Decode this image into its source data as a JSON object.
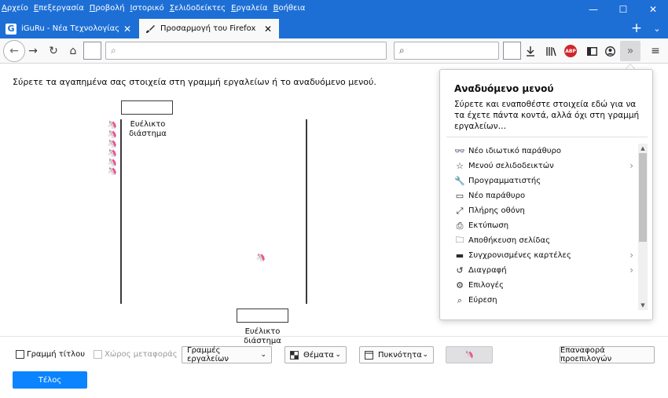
{
  "menubar": [
    "Αρχείο",
    "Επεξεργασία",
    "Προβολή",
    "Ιστορικό",
    "Σελιδοδείκτες",
    "Εργαλεία",
    "Βοήθεια"
  ],
  "window_controls": {
    "minimize": "—",
    "maximize": "☐",
    "close": "✕"
  },
  "tabs": [
    {
      "favicon": "G",
      "label": "iGuRu - Νέα Τεχνολογίας σε πρ",
      "close": "✕"
    },
    {
      "favicon": "paintbrush-icon",
      "label": "Προσαρμογή του Firefox",
      "close": "✕"
    }
  ],
  "tabbar": {
    "add": "+",
    "list": "⌄"
  },
  "navbar": {
    "back": "←",
    "forward": "→",
    "reload": "↻",
    "home": "⌂",
    "search_glyph": "⌕",
    "abp_label": "ABP",
    "overflow": "»",
    "menu": "≡"
  },
  "customize": {
    "instructions": "Σύρετε τα αγαπημένα σας στοιχεία στη γραμμή εργαλείων ή το αναδυόμενο μενού.",
    "flex_label_1": "Ευέλικτο διάστημα",
    "flex_label_2": "Ευέλικτο διάστημα"
  },
  "overflow_panel": {
    "title": "Αναδυόμενο μενού",
    "description": "Σύρετε και εναποθέστε στοιχεία εδώ για να τα έχετε πάντα κοντά, αλλά όχι στη γραμμή εργαλείων…",
    "items": [
      {
        "icon": "mask-icon",
        "glyph": "👓",
        "label": "Νέο ιδιωτικό παράθυρο",
        "submenu": false
      },
      {
        "icon": "bookmark-star-icon",
        "glyph": "☆",
        "label": "Μενού σελιδοδεικτών",
        "submenu": true
      },
      {
        "icon": "wrench-icon",
        "glyph": "🔧",
        "label": "Προγραμματιστής",
        "submenu": false
      },
      {
        "icon": "window-icon",
        "glyph": "▭",
        "label": "Νέο παράθυρο",
        "submenu": false
      },
      {
        "icon": "fullscreen-icon",
        "glyph": "⤢",
        "label": "Πλήρης οθόνη",
        "submenu": false
      },
      {
        "icon": "printer-icon",
        "glyph": "⎙",
        "label": "Εκτύπωση",
        "submenu": false
      },
      {
        "icon": "folder-icon",
        "glyph": "🗀",
        "label": "Αποθήκευση σελίδας",
        "submenu": false
      },
      {
        "icon": "synced-tabs-icon",
        "glyph": "▬",
        "label": "Συγχρονισμένες καρτέλες",
        "submenu": true
      },
      {
        "icon": "history-icon",
        "glyph": "↺",
        "label": "Διαγραφή",
        "submenu": true
      },
      {
        "icon": "gear-icon",
        "glyph": "⚙",
        "label": "Επιλογές",
        "submenu": false
      },
      {
        "icon": "search-icon",
        "glyph": "⌕",
        "label": "Εύρεση",
        "submenu": false
      }
    ],
    "chevron": "›",
    "scroll_up": "▲",
    "scroll_down": "▼"
  },
  "footer": {
    "title_bar_checkbox": "Γραμμή τίτλου",
    "drag_space_checkbox": "Χώρος μεταφοράς",
    "toolbars_dropdown": "Γραμμές εργαλείων",
    "themes_dropdown": "Θέματα",
    "density_dropdown": "Πυκνότητα",
    "caret": "⌄",
    "reset_button": "Επαναφορά προεπιλογών",
    "done_button": "Τέλος"
  }
}
